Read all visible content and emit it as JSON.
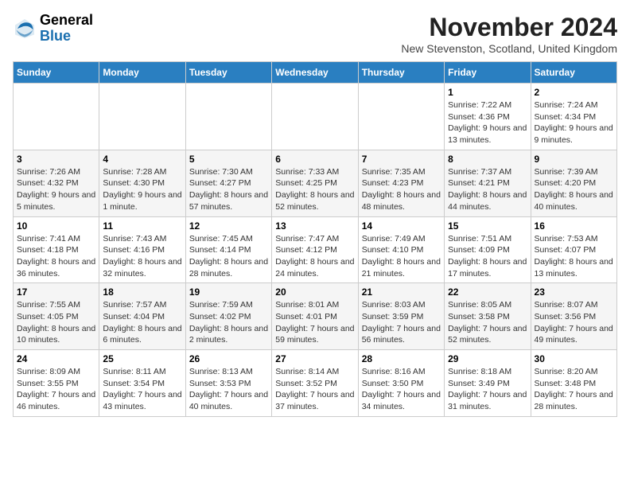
{
  "header": {
    "logo_general": "General",
    "logo_blue": "Blue",
    "month_year": "November 2024",
    "location": "New Stevenston, Scotland, United Kingdom"
  },
  "weekdays": [
    "Sunday",
    "Monday",
    "Tuesday",
    "Wednesday",
    "Thursday",
    "Friday",
    "Saturday"
  ],
  "weeks": [
    [
      {
        "day": "",
        "info": ""
      },
      {
        "day": "",
        "info": ""
      },
      {
        "day": "",
        "info": ""
      },
      {
        "day": "",
        "info": ""
      },
      {
        "day": "",
        "info": ""
      },
      {
        "day": "1",
        "info": "Sunrise: 7:22 AM\nSunset: 4:36 PM\nDaylight: 9 hours and 13 minutes."
      },
      {
        "day": "2",
        "info": "Sunrise: 7:24 AM\nSunset: 4:34 PM\nDaylight: 9 hours and 9 minutes."
      }
    ],
    [
      {
        "day": "3",
        "info": "Sunrise: 7:26 AM\nSunset: 4:32 PM\nDaylight: 9 hours and 5 minutes."
      },
      {
        "day": "4",
        "info": "Sunrise: 7:28 AM\nSunset: 4:30 PM\nDaylight: 9 hours and 1 minute."
      },
      {
        "day": "5",
        "info": "Sunrise: 7:30 AM\nSunset: 4:27 PM\nDaylight: 8 hours and 57 minutes."
      },
      {
        "day": "6",
        "info": "Sunrise: 7:33 AM\nSunset: 4:25 PM\nDaylight: 8 hours and 52 minutes."
      },
      {
        "day": "7",
        "info": "Sunrise: 7:35 AM\nSunset: 4:23 PM\nDaylight: 8 hours and 48 minutes."
      },
      {
        "day": "8",
        "info": "Sunrise: 7:37 AM\nSunset: 4:21 PM\nDaylight: 8 hours and 44 minutes."
      },
      {
        "day": "9",
        "info": "Sunrise: 7:39 AM\nSunset: 4:20 PM\nDaylight: 8 hours and 40 minutes."
      }
    ],
    [
      {
        "day": "10",
        "info": "Sunrise: 7:41 AM\nSunset: 4:18 PM\nDaylight: 8 hours and 36 minutes."
      },
      {
        "day": "11",
        "info": "Sunrise: 7:43 AM\nSunset: 4:16 PM\nDaylight: 8 hours and 32 minutes."
      },
      {
        "day": "12",
        "info": "Sunrise: 7:45 AM\nSunset: 4:14 PM\nDaylight: 8 hours and 28 minutes."
      },
      {
        "day": "13",
        "info": "Sunrise: 7:47 AM\nSunset: 4:12 PM\nDaylight: 8 hours and 24 minutes."
      },
      {
        "day": "14",
        "info": "Sunrise: 7:49 AM\nSunset: 4:10 PM\nDaylight: 8 hours and 21 minutes."
      },
      {
        "day": "15",
        "info": "Sunrise: 7:51 AM\nSunset: 4:09 PM\nDaylight: 8 hours and 17 minutes."
      },
      {
        "day": "16",
        "info": "Sunrise: 7:53 AM\nSunset: 4:07 PM\nDaylight: 8 hours and 13 minutes."
      }
    ],
    [
      {
        "day": "17",
        "info": "Sunrise: 7:55 AM\nSunset: 4:05 PM\nDaylight: 8 hours and 10 minutes."
      },
      {
        "day": "18",
        "info": "Sunrise: 7:57 AM\nSunset: 4:04 PM\nDaylight: 8 hours and 6 minutes."
      },
      {
        "day": "19",
        "info": "Sunrise: 7:59 AM\nSunset: 4:02 PM\nDaylight: 8 hours and 2 minutes."
      },
      {
        "day": "20",
        "info": "Sunrise: 8:01 AM\nSunset: 4:01 PM\nDaylight: 7 hours and 59 minutes."
      },
      {
        "day": "21",
        "info": "Sunrise: 8:03 AM\nSunset: 3:59 PM\nDaylight: 7 hours and 56 minutes."
      },
      {
        "day": "22",
        "info": "Sunrise: 8:05 AM\nSunset: 3:58 PM\nDaylight: 7 hours and 52 minutes."
      },
      {
        "day": "23",
        "info": "Sunrise: 8:07 AM\nSunset: 3:56 PM\nDaylight: 7 hours and 49 minutes."
      }
    ],
    [
      {
        "day": "24",
        "info": "Sunrise: 8:09 AM\nSunset: 3:55 PM\nDaylight: 7 hours and 46 minutes."
      },
      {
        "day": "25",
        "info": "Sunrise: 8:11 AM\nSunset: 3:54 PM\nDaylight: 7 hours and 43 minutes."
      },
      {
        "day": "26",
        "info": "Sunrise: 8:13 AM\nSunset: 3:53 PM\nDaylight: 7 hours and 40 minutes."
      },
      {
        "day": "27",
        "info": "Sunrise: 8:14 AM\nSunset: 3:52 PM\nDaylight: 7 hours and 37 minutes."
      },
      {
        "day": "28",
        "info": "Sunrise: 8:16 AM\nSunset: 3:50 PM\nDaylight: 7 hours and 34 minutes."
      },
      {
        "day": "29",
        "info": "Sunrise: 8:18 AM\nSunset: 3:49 PM\nDaylight: 7 hours and 31 minutes."
      },
      {
        "day": "30",
        "info": "Sunrise: 8:20 AM\nSunset: 3:48 PM\nDaylight: 7 hours and 28 minutes."
      }
    ]
  ]
}
